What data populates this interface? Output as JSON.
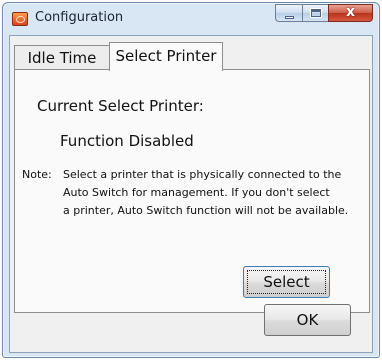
{
  "window": {
    "title": "Configuration",
    "close_glyph": "x",
    "app_icon": "configuration-app-icon"
  },
  "tabs": [
    {
      "label": "Idle Time",
      "selected": false
    },
    {
      "label": "Select Printer",
      "selected": true
    }
  ],
  "panel": {
    "current_label": "Current Select Printer:",
    "status": "Function Disabled",
    "note_prefix": "Note:",
    "note_lines": [
      "Select a printer that is physically connected to the",
      "Auto Switch for management. If you don't  select",
      "a printer, Auto Switch function will not be available."
    ],
    "select_button": "Select"
  },
  "footer": {
    "ok_button": "OK"
  },
  "colors": {
    "frame": "#d9e7f5",
    "close_button": "#c9452e",
    "client_bg": "#f0f0f0"
  }
}
